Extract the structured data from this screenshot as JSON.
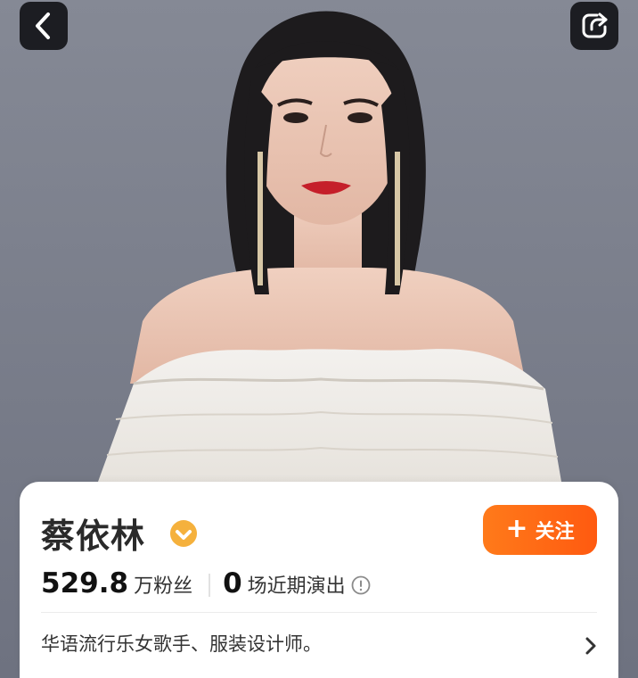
{
  "profile": {
    "name": "蔡依林",
    "verified_icon": "verified-check-icon",
    "follow_label": "关注",
    "follow_icon": "plus-icon",
    "fans_value": "529.8",
    "fans_unit": "万粉丝",
    "shows_value": "0",
    "shows_unit": "场近期演出",
    "bio": "华语流行乐女歌手、服装设计师。"
  },
  "nav": {
    "back_icon": "chevron-left-icon",
    "share_icon": "share-icon"
  },
  "colors": {
    "accent": "#ff6a12",
    "verified": "#f5b13d",
    "hero_bg": "#7b7f8b",
    "card_bg": "#ffffff"
  }
}
